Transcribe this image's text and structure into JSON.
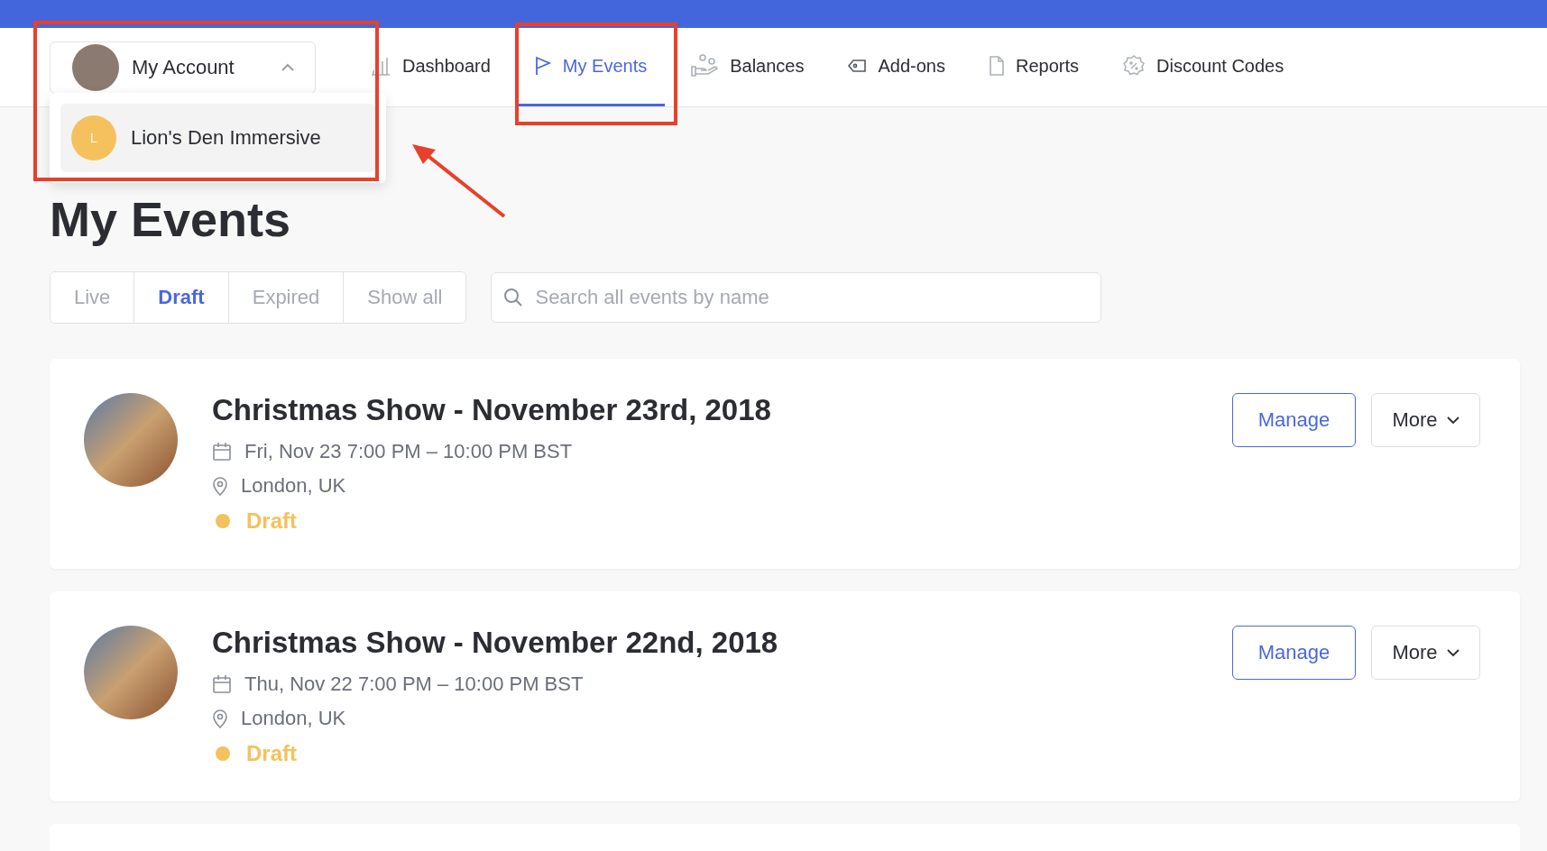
{
  "account_menu": {
    "label": "My Account",
    "expanded": true,
    "options": [
      {
        "initial": "L",
        "name": "Lion's Den Immersive",
        "selected": true
      }
    ]
  },
  "nav": [
    {
      "label": "Dashboard",
      "selected": false
    },
    {
      "label": "My Events",
      "selected": true
    },
    {
      "label": "Balances",
      "selected": false
    },
    {
      "label": "Add-ons",
      "selected": false
    },
    {
      "label": "Reports",
      "selected": false
    },
    {
      "label": "Discount Codes",
      "selected": false
    }
  ],
  "heading": "My Events",
  "filters": [
    {
      "label": "Live",
      "selected": false
    },
    {
      "label": "Draft",
      "selected": true
    },
    {
      "label": "Expired",
      "selected": false
    },
    {
      "label": "Show all",
      "selected": false
    }
  ],
  "search": {
    "placeholder": "Search all events by name"
  },
  "events": [
    {
      "title": "Christmas Show - November 23rd, 2018",
      "when": "Fri, Nov 23 7:00 PM – 10:00 PM BST",
      "where": "London, UK",
      "status": "Draft",
      "primary_action": "Manage",
      "secondary_action": "More"
    },
    {
      "title": "Christmas Show - November 22nd, 2018",
      "when": "Thu, Nov 22 7:00 PM – 10:00 PM BST",
      "where": "London, UK",
      "status": "Draft",
      "primary_action": "Manage",
      "secondary_action": "More"
    }
  ]
}
